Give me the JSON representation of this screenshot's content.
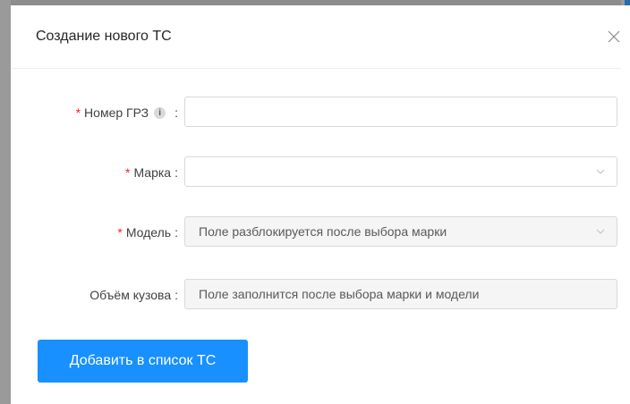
{
  "dialog": {
    "title": "Создание нового ТС",
    "close_icon": "close-icon"
  },
  "form": {
    "plate": {
      "label": "Номер ГРЗ",
      "required": true,
      "info_icon": "i",
      "value": ""
    },
    "brand": {
      "label": "Марка",
      "required": true,
      "value": ""
    },
    "model": {
      "label": "Модель",
      "required": true,
      "placeholder": "Поле разблокируется после выбора марки",
      "disabled": true
    },
    "volume": {
      "label": "Объём кузова",
      "required": false,
      "placeholder": "Поле заполнится после выбора марки и модели",
      "disabled": true
    }
  },
  "actions": {
    "submit_label": "Добавить в список ТС"
  },
  "colors": {
    "primary": "#1890ff",
    "required": "#f5222d",
    "disabled_bg": "#f5f5f5",
    "border": "#d9d9d9"
  }
}
